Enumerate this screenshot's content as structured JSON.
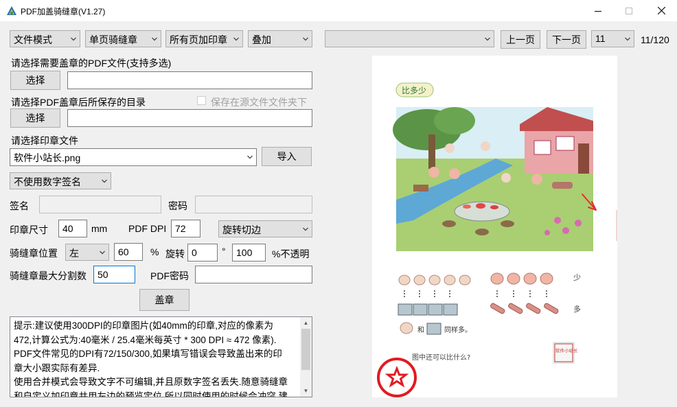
{
  "window": {
    "title": "PDF加盖骑缝章(V1.27)"
  },
  "toolbar": {
    "mode": "文件模式",
    "seal_type": "单页骑缝章",
    "page_scope": "所有页加印章",
    "overlay": "叠加",
    "file_select": "",
    "prev_label": "上一页",
    "next_label": "下一页",
    "page_number": "11",
    "page_count": "11/120"
  },
  "form": {
    "pdf_files_label": "请选择需要盖章的PDF文件(支持多选)",
    "select_label": "选择",
    "pdf_files_value": "",
    "save_dir_label": "请选择PDF盖章后所保存的目录",
    "save_in_source_label": "保存在源文件文件夹下",
    "save_dir_value": "",
    "stamp_file_label": "请选择印章文件",
    "stamp_file_value": "软件小站长.png",
    "import_label": "导入",
    "digital_sign": "不使用数字签名",
    "sign_name_label": "签名",
    "sign_name_value": "",
    "password_label": "密码",
    "password_value": "",
    "stamp_size_label": "印章尺寸",
    "stamp_size_value": "40",
    "stamp_size_unit": "mm",
    "pdf_dpi_label": "PDF DPI",
    "pdf_dpi_value": "72",
    "rotate_mode": "旋转切边",
    "seam_pos_label": "骑缝章位置",
    "seam_pos_value": "左",
    "seam_pos_percent": "60",
    "percent_sign": "%",
    "rotate_label": "旋转",
    "rotate_value": "0",
    "degree_sign": "°",
    "opacity_value": "100",
    "opacity_label": "%不透明",
    "max_split_label": "骑缝章最大分割数",
    "max_split_value": "50",
    "pdf_password_label": "PDF密码",
    "pdf_password_value": "",
    "stamp_button_label": "盖章"
  },
  "info": {
    "lines": [
      "提示:建议使用300DPI的印章图片(如40mm的印章,对应的像素为",
      "472,计算公式为:40毫米 / 25.4毫米每英寸 * 300 DPI ≈ 472 像素).",
      "PDF文件常见的DPI有72/150/300,如果填写错误会导致盖出来的印",
      "章大小跟实际有差异.",
      "使用合并模式会导致文字不可编辑,并且原数字签名丢失.随意骑缝章",
      "和自定义加印章共用左边的预览定位,所以同时使用的时候会冲突,建"
    ]
  },
  "preview": {
    "badge": "比多少",
    "row_label_less": "少",
    "row_label_more": "多",
    "compare_and": "和",
    "compare_same": "同样多。",
    "question": "图中还可以比什么?",
    "stamp_text": "软件小站长",
    "colors": {
      "stamp_red": "#e11b22",
      "arrow_red": "#e52e2e"
    }
  }
}
